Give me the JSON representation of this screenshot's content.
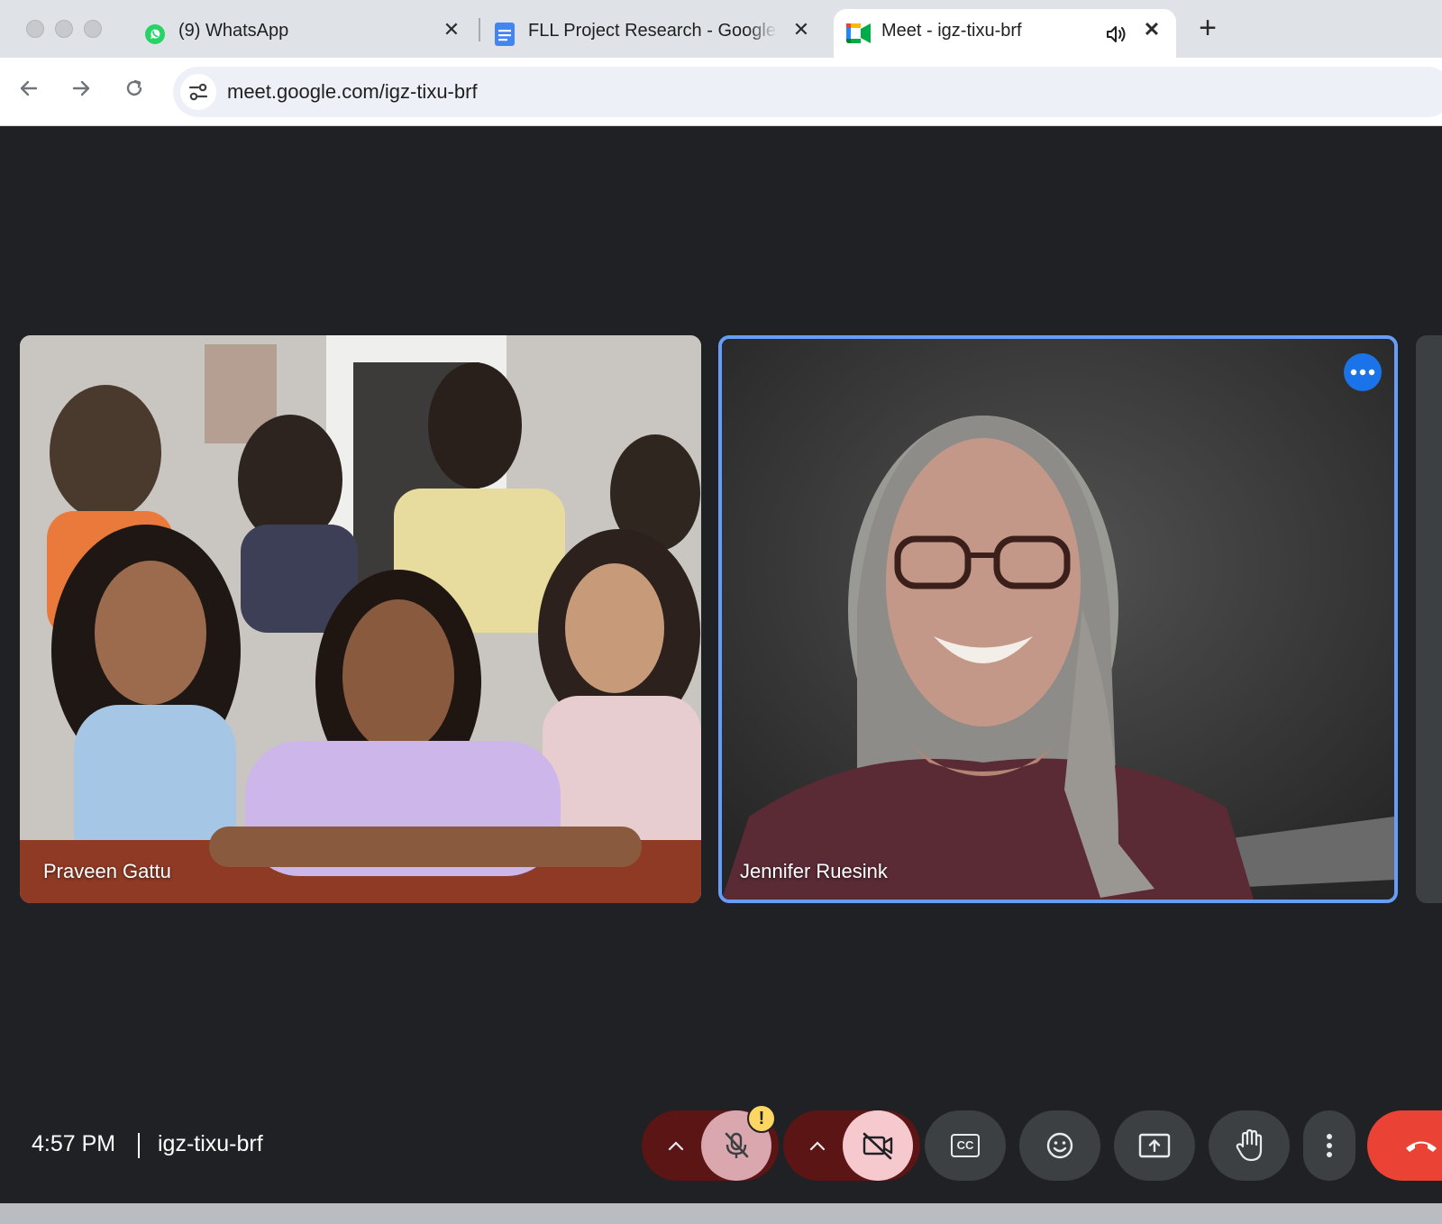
{
  "tabs": [
    {
      "title": "(9) WhatsApp",
      "icon": "whatsapp-icon"
    },
    {
      "title": "FLL Project Research - Google",
      "icon": "google-docs-icon"
    },
    {
      "title": "Meet - igz-tixu-brf",
      "icon": "google-meet-icon",
      "active": true,
      "audio": true
    }
  ],
  "new_tab_label": "+",
  "address_bar": {
    "url": "meet.google.com/igz-tixu-brf"
  },
  "meeting": {
    "participants": [
      {
        "name": "Praveen Gattu"
      },
      {
        "name": "Jennifer Ruesink",
        "highlighted": true
      }
    ],
    "time": "4:57 PM",
    "code": "igz-tixu-brf"
  },
  "controls": {
    "mic": {
      "state": "muted",
      "warning": "!"
    },
    "camera": {
      "state": "off"
    },
    "captions_label": "CC"
  },
  "colors": {
    "accent": "#1a73e8",
    "tile_border": "#669df6",
    "muted_bg": "#f5c9ce",
    "muted_dark": "#8c1d18",
    "hangup": "#ea4335",
    "warning": "#fdd663"
  }
}
